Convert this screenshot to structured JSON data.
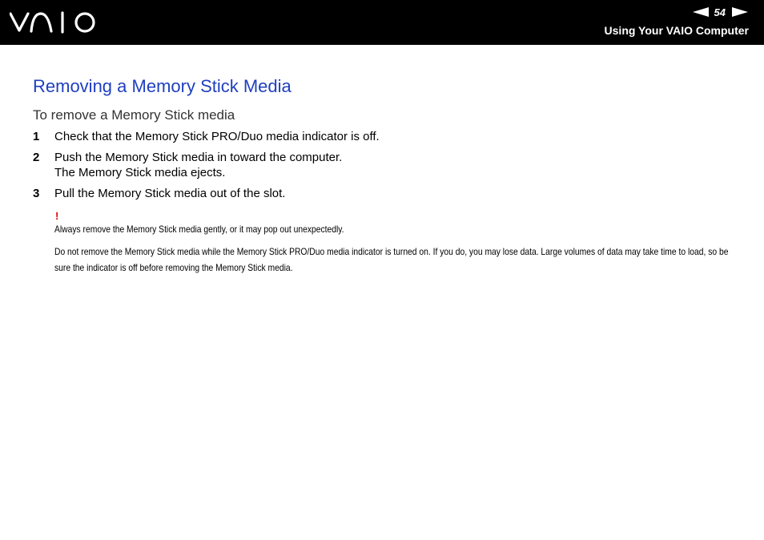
{
  "header": {
    "logo_text": "VAIO",
    "page_number": "54",
    "section_title": "Using Your VAIO Computer"
  },
  "main": {
    "title": "Removing a Memory Stick Media",
    "subtitle": "To remove a Memory Stick media",
    "steps": [
      {
        "number": "1",
        "text": "Check that the Memory Stick PRO/Duo media indicator is off."
      },
      {
        "number": "2",
        "text": "Push the Memory Stick media in toward the computer.",
        "subtext": "The Memory Stick media ejects."
      },
      {
        "number": "3",
        "text": "Pull the Memory Stick media out of the slot."
      }
    ],
    "warning_symbol": "!",
    "notes": [
      "Always remove the Memory Stick media gently, or it may pop out unexpectedly.",
      "Do not remove the Memory Stick media while the Memory Stick PRO/Duo media indicator is turned on. If you do, you may lose data. Large volumes of data may take time to load, so be sure the indicator is off before removing the Memory Stick media."
    ]
  },
  "colors": {
    "header_bg": "#000000",
    "title": "#1f3fbf",
    "warning": "#e00000"
  }
}
